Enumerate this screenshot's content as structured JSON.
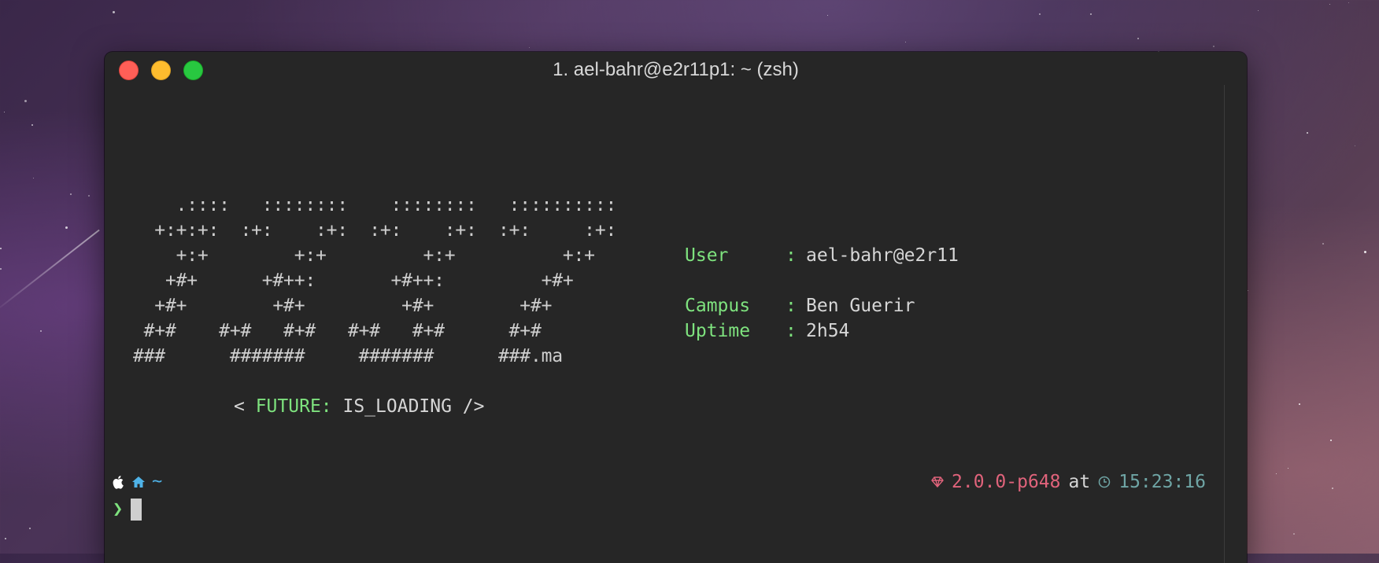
{
  "window": {
    "title": "1. ael-bahr@e2r11p1: ~ (zsh)"
  },
  "ascii_art": {
    "lines": [
      "    .::::   ::::::::    ::::::::   ::::::::::",
      "  +:+:+:  :+:    :+:  :+:    :+:  :+:     :+:",
      "    +:+        +:+         +:+          +:+",
      "   +#+      +#++:       +#++:         +#+",
      "  +#+        +#+         +#+        +#+",
      " #+#    #+#   #+#   #+#   #+#      #+#",
      "###      #######     #######      ###.ma"
    ]
  },
  "info": {
    "user_key": "User",
    "user_value": "ael-bahr@e2r11",
    "campus_key": "Campus",
    "campus_value": "Ben Guerir",
    "uptime_key": "Uptime",
    "uptime_value": "2h54",
    "separator": ":"
  },
  "tagline": {
    "open": "< ",
    "keyword": "FUTURE:",
    "rest": " IS_LOADING />"
  },
  "prompt": {
    "directory": "~",
    "symbol": "❯",
    "ruby_version": "2.0.0-p648",
    "at_word": "at",
    "time": "15:23:16"
  },
  "colors": {
    "accent_green": "#7ee27e",
    "ruby_red": "#e0637b",
    "path_blue": "#4fb3e8",
    "time_teal": "#6fa5a5"
  }
}
